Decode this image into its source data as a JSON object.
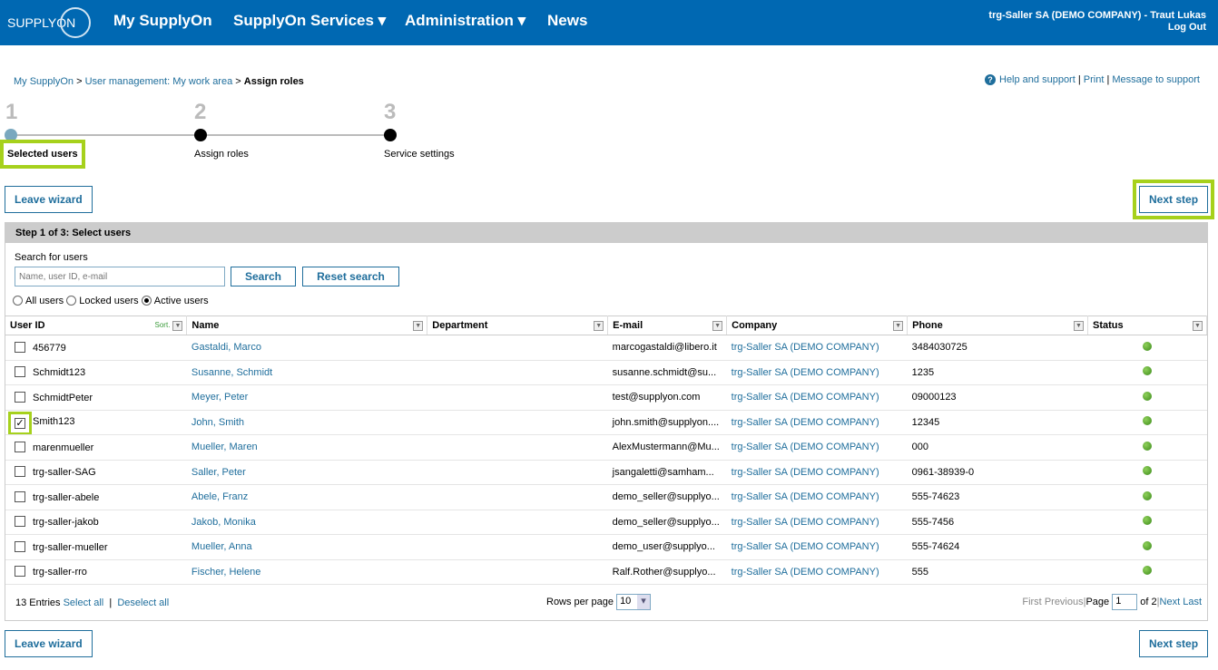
{
  "header": {
    "logo": "SUPPLYON",
    "nav": [
      {
        "label": "My SupplyOn"
      },
      {
        "label": "SupplyOn Services ▾"
      },
      {
        "label": "Administration ▾"
      },
      {
        "label": "News"
      }
    ],
    "user": "trg-Saller SA (DEMO COMPANY) - Traut Lukas",
    "logout": "Log Out"
  },
  "breadcrumb": {
    "items": [
      "My SupplyOn",
      "User management: My work area"
    ],
    "sep": ">",
    "current": "Assign roles"
  },
  "help": {
    "help": "Help and support",
    "print": "Print",
    "message": "Message to support"
  },
  "wizard": {
    "steps": [
      {
        "num": "1",
        "label": "Selected users"
      },
      {
        "num": "2",
        "label": "Assign roles"
      },
      {
        "num": "3",
        "label": "Service settings"
      }
    ]
  },
  "buttons": {
    "leave": "Leave wizard",
    "next": "Next step",
    "search": "Search",
    "reset": "Reset search"
  },
  "panel": {
    "title": "Step 1 of 3: Select users",
    "search_label": "Search for users",
    "search_placeholder": "Name, user ID, e-mail",
    "radios": [
      {
        "label": "All users",
        "checked": false
      },
      {
        "label": "Locked users",
        "checked": false
      },
      {
        "label": "Active users",
        "checked": true
      }
    ]
  },
  "table": {
    "columns": [
      "User ID",
      "Name",
      "Department",
      "E-mail",
      "Company",
      "Phone",
      "Status"
    ],
    "sort_label": "Sort.",
    "rows": [
      {
        "id": "456779",
        "name": "Gastaldi, Marco",
        "dept": "",
        "email": "marcogastaldi@libero.it",
        "company": "trg-Saller SA (DEMO COMPANY)",
        "phone": "3484030725",
        "checked": false
      },
      {
        "id": "Schmidt123",
        "name": "Susanne, Schmidt",
        "dept": "",
        "email": "susanne.schmidt@su...",
        "company": "trg-Saller SA (DEMO COMPANY)",
        "phone": "1235",
        "checked": false
      },
      {
        "id": "SchmidtPeter",
        "name": "Meyer, Peter",
        "dept": "",
        "email": "test@supplyon.com",
        "company": "trg-Saller SA (DEMO COMPANY)",
        "phone": "09000123",
        "checked": false
      },
      {
        "id": "Smith123",
        "name": "John, Smith",
        "dept": "",
        "email": "john.smith@supplyon....",
        "company": "trg-Saller SA (DEMO COMPANY)",
        "phone": "12345",
        "checked": true
      },
      {
        "id": "marenmueller",
        "name": "Mueller, Maren",
        "dept": "",
        "email": "AlexMustermann@Mu...",
        "company": "trg-Saller SA (DEMO COMPANY)",
        "phone": "000",
        "checked": false
      },
      {
        "id": "trg-saller-SAG",
        "name": "Saller, Peter",
        "dept": "",
        "email": "jsangaletti@samham...",
        "company": "trg-Saller SA (DEMO COMPANY)",
        "phone": "0961-38939-0",
        "checked": false
      },
      {
        "id": "trg-saller-abele",
        "name": "Abele, Franz",
        "dept": "",
        "email": "demo_seller@supplyo...",
        "company": "trg-Saller SA (DEMO COMPANY)",
        "phone": "555-74623",
        "checked": false
      },
      {
        "id": "trg-saller-jakob",
        "name": "Jakob, Monika",
        "dept": "",
        "email": "demo_seller@supplyo...",
        "company": "trg-Saller SA (DEMO COMPANY)",
        "phone": "555-7456",
        "checked": false
      },
      {
        "id": "trg-saller-mueller",
        "name": "Mueller, Anna",
        "dept": "",
        "email": "demo_user@supplyo...",
        "company": "trg-Saller SA (DEMO COMPANY)",
        "phone": "555-74624",
        "checked": false
      },
      {
        "id": "trg-saller-rro",
        "name": "Fischer, Helene",
        "dept": "",
        "email": "Ralf.Rother@supplyo...",
        "company": "trg-Saller SA (DEMO COMPANY)",
        "phone": "555",
        "checked": false
      }
    ]
  },
  "footer": {
    "entries": "13 Entries",
    "select_all": "Select all",
    "deselect_all": "Deselect all",
    "rows_label": "Rows per page",
    "rows_value": "10",
    "first": "First",
    "previous": "Previous",
    "page_label": "Page",
    "page": "1",
    "of": "of 2",
    "next": "Next",
    "last": "Last"
  },
  "colors": {
    "header": "#0068b2",
    "link": "#1f6e9c",
    "highlight": "#a6d11c",
    "status_active": "#4a9a26"
  }
}
